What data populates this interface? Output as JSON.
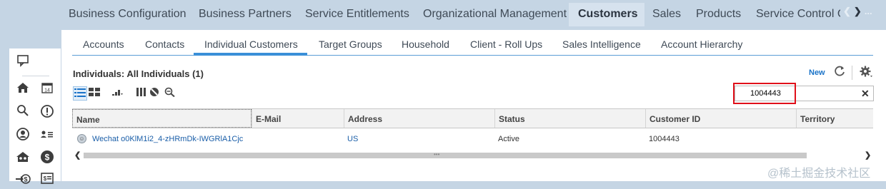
{
  "topnav": {
    "items": [
      "Business Configuration",
      "Business Partners",
      "Service Entitlements",
      "Organizational Management",
      "Customers",
      "Sales",
      "Products",
      "Service Control C"
    ],
    "active": "Customers",
    "more_label": "..."
  },
  "tabs": [
    "Accounts",
    "Contacts",
    "Individual Customers",
    "Target Groups",
    "Household",
    "Client - Roll Ups",
    "Sales Intelligence",
    "Account Hierarchy"
  ],
  "list": {
    "title": "Individuals: All Individuals (1)",
    "new_label": "New"
  },
  "search": {
    "value": "1004443"
  },
  "table": {
    "columns": [
      "Name",
      "E-Mail",
      "Address",
      "Status",
      "Customer ID",
      "Territory"
    ],
    "rows": [
      {
        "name": "Wechat o0KlM1i2_4-zHRmDk-IWGRlA1Cjc",
        "email": "",
        "address": "US",
        "status": "Active",
        "customer_id": "1004443",
        "territory": ""
      }
    ]
  },
  "watermark": "@稀土掘金技术社区",
  "colors": {
    "accent": "#3a8fd8",
    "highlight": "#e0101a",
    "nav_bg": "#c5d5e4"
  }
}
